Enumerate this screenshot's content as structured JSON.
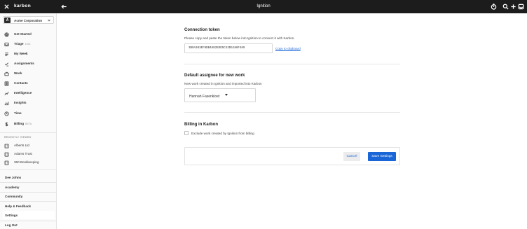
{
  "topbar": {
    "brand": "karbon",
    "title": "Ignition",
    "icons": [
      "close-icon",
      "back-arrow-icon",
      "stopwatch-icon",
      "search-icon",
      "plus-icon",
      "inbox-icon"
    ]
  },
  "sidebar": {
    "org": {
      "avatar_letter": "A",
      "name": "Acme Corporation"
    },
    "nav": [
      {
        "label": "Get Started",
        "tag": "",
        "icon": "star-icon"
      },
      {
        "label": "Triage",
        "tag": "1924",
        "icon": "triage-icon"
      },
      {
        "label": "My Week",
        "tag": "",
        "icon": "my-week-icon"
      },
      {
        "label": "Assignments",
        "tag": "",
        "icon": "assignments-icon"
      },
      {
        "label": "Work",
        "tag": "",
        "icon": "briefcase-icon"
      },
      {
        "label": "Contacts",
        "tag": "",
        "icon": "contacts-icon"
      },
      {
        "label": "Intelligence",
        "tag": "",
        "icon": "intelligence-icon"
      },
      {
        "label": "Insights",
        "tag": "",
        "icon": "insights-icon"
      },
      {
        "label": "Time",
        "tag": "",
        "icon": "clock-icon"
      },
      {
        "label": "Billing",
        "tag": "BETA",
        "icon": "dollar-icon"
      }
    ],
    "recently_viewed_heading": "RECENTLY VIEWED",
    "recent": [
      {
        "label": "Alberts Ltd",
        "icon": "building-icon"
      },
      {
        "label": "Adams Trust",
        "icon": "building-icon"
      },
      {
        "label": "360 Bookkeeping",
        "icon": "building-icon"
      }
    ],
    "footer": [
      "Dee Johns",
      "Academy",
      "Community",
      "Help & Feedback",
      "Settings",
      "Log Out"
    ]
  },
  "main": {
    "connection": {
      "heading": "Connection token",
      "desc": "Please copy and paste the token below into Ignition to connect it with Karbon.",
      "token": "3B9A303EF8DB4602B3D5C43D5186F469",
      "copy_label": "Copy to clipboard"
    },
    "assignee": {
      "heading": "Default assignee for new work",
      "desc": "New work created in Ignition and imported into Karbon",
      "selected": "Hannah Fasenkloet"
    },
    "billing": {
      "heading": "Billing in Karbon",
      "checkbox_label": "Exclude work created by Ignition from billing"
    },
    "actions": {
      "cancel": "Cancel",
      "save": "Save Settings"
    }
  }
}
